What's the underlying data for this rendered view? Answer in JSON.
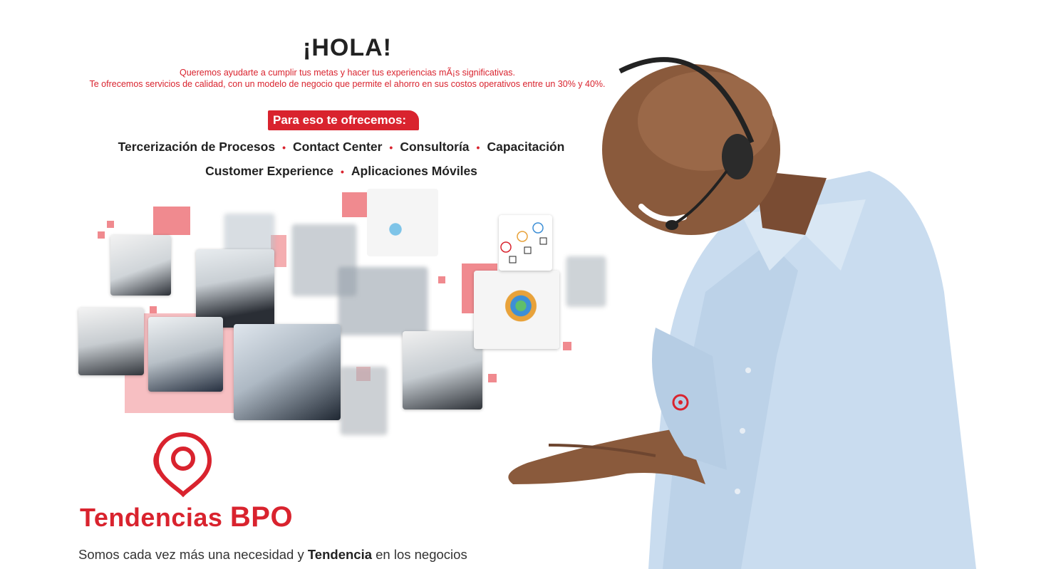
{
  "hero": {
    "title": "¡HOLA!",
    "subtitle_line1": "Queremos ayudarte a cumplir tus metas y hacer tus experiencias mÃ¡s significativas.",
    "subtitle_line2": "Te ofrecemos servicios de calidad, con un modelo de negocio que permite el ahorro en sus costos operativos entre un 30% y 40%.",
    "badge": "Para eso te ofrecemos:"
  },
  "services_row1": [
    "Tercerización de Procesos",
    "Contact Center",
    "Consultoría",
    "Capacitación"
  ],
  "services_row2": [
    "Customer Experience",
    "Aplicaciones Móviles"
  ],
  "separator": "•",
  "brand": {
    "name_part1": "Tendencias",
    "name_part2": "BPO",
    "logo_icon": "location-pin-icon"
  },
  "tagline": {
    "before": "Somos cada vez más una necesidad y",
    "bold": "Tendencia",
    "after": "en los negocios"
  },
  "colors": {
    "accent": "#d9232e",
    "soft_accent": "#f08a8f",
    "shirt": "#c9dcef",
    "skin": "#8a5a3c",
    "text": "#222222"
  }
}
